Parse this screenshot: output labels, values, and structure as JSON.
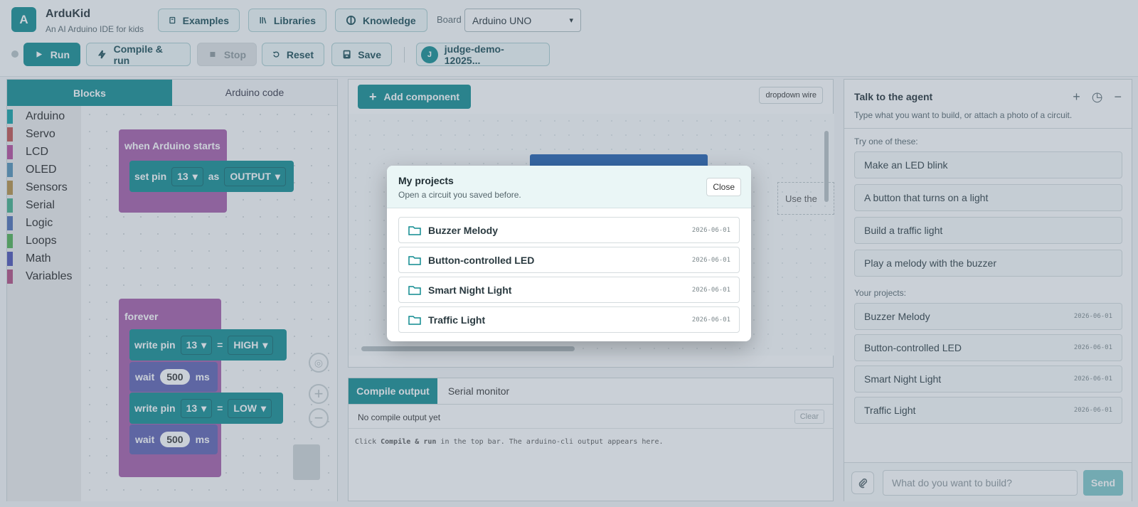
{
  "app": {
    "logo_letter": "A",
    "title": "ArduKid",
    "subtitle": "An AI Arduino IDE for kids"
  },
  "header": {
    "examples": "Examples",
    "libraries": "Libraries",
    "knowledge": "Knowledge",
    "board_label": "Board",
    "board_value": "Arduino UNO",
    "run": "Run",
    "compile_run": "Compile & run",
    "stop": "Stop",
    "reset": "Reset",
    "save": "Save",
    "user_initial": "J",
    "user_name": "judge-demo-12025..."
  },
  "left": {
    "tab_blocks": "Blocks",
    "tab_code": "Arduino code",
    "categories": [
      {
        "label": "Arduino",
        "color": "#0f9ea3"
      },
      {
        "label": "Servo",
        "color": "#c0504d"
      },
      {
        "label": "LCD",
        "color": "#b5489a"
      },
      {
        "label": "OLED",
        "color": "#4f8fb5"
      },
      {
        "label": "Sensors",
        "color": "#b58e42"
      },
      {
        "label": "Serial",
        "color": "#3fae87"
      },
      {
        "label": "Logic",
        "color": "#4a6cb3"
      },
      {
        "label": "Loops",
        "color": "#4caf50"
      },
      {
        "label": "Math",
        "color": "#4a4fb3"
      },
      {
        "label": "Variables",
        "color": "#b04a7e"
      }
    ],
    "blocks": {
      "setup_hat": "when Arduino starts",
      "set_pin": "set pin",
      "pin_13": "13",
      "as": "as",
      "output": "OUTPUT",
      "forever": "forever",
      "write_pin": "write pin",
      "equals": "=",
      "high": "HIGH",
      "low": "LOW",
      "wait": "wait",
      "wait_value": "500",
      "ms": "ms"
    }
  },
  "center": {
    "add_component": "Add component",
    "dropdown_wire": "dropdown wire",
    "hint": "Use the",
    "tab_compile": "Compile output",
    "tab_serial": "Serial monitor",
    "empty": "No compile output yet",
    "clear": "Clear",
    "hint_pre": "Click ",
    "hint_cmd": "Compile & run",
    "hint_post": " in the top bar. The arduino-cli output appears here."
  },
  "agent": {
    "title": "Talk to the agent",
    "subtitle": "Type what you want to build, or attach a photo of a circuit.",
    "try_label": "Try one of these:",
    "suggestions": [
      "Make an LED blink",
      "A button that turns on a light",
      "Build a traffic light",
      "Play a melody with the buzzer"
    ],
    "projects_label": "Your projects:",
    "projects": [
      {
        "name": "Buzzer Melody",
        "date": "2026-06-01"
      },
      {
        "name": "Button-controlled LED",
        "date": "2026-06-01"
      },
      {
        "name": "Smart Night Light",
        "date": "2026-06-01"
      },
      {
        "name": "Traffic Light",
        "date": "2026-06-01"
      }
    ],
    "input_placeholder": "What do you want to build?",
    "send": "Send"
  },
  "modal": {
    "title": "My projects",
    "subtitle": "Open a circuit you saved before.",
    "close": "Close",
    "projects": [
      {
        "name": "Buzzer Melody",
        "date": "2026-06-01"
      },
      {
        "name": "Button-controlled LED",
        "date": "2026-06-01"
      },
      {
        "name": "Smart Night Light",
        "date": "2026-06-01"
      },
      {
        "name": "Traffic Light",
        "date": "2026-06-01"
      }
    ]
  },
  "colors": {
    "accent": "#0f8a8f",
    "setup_block": "#a45aa8",
    "pin_block": "#0f8a8f",
    "wait_block": "#5b5fb0"
  }
}
